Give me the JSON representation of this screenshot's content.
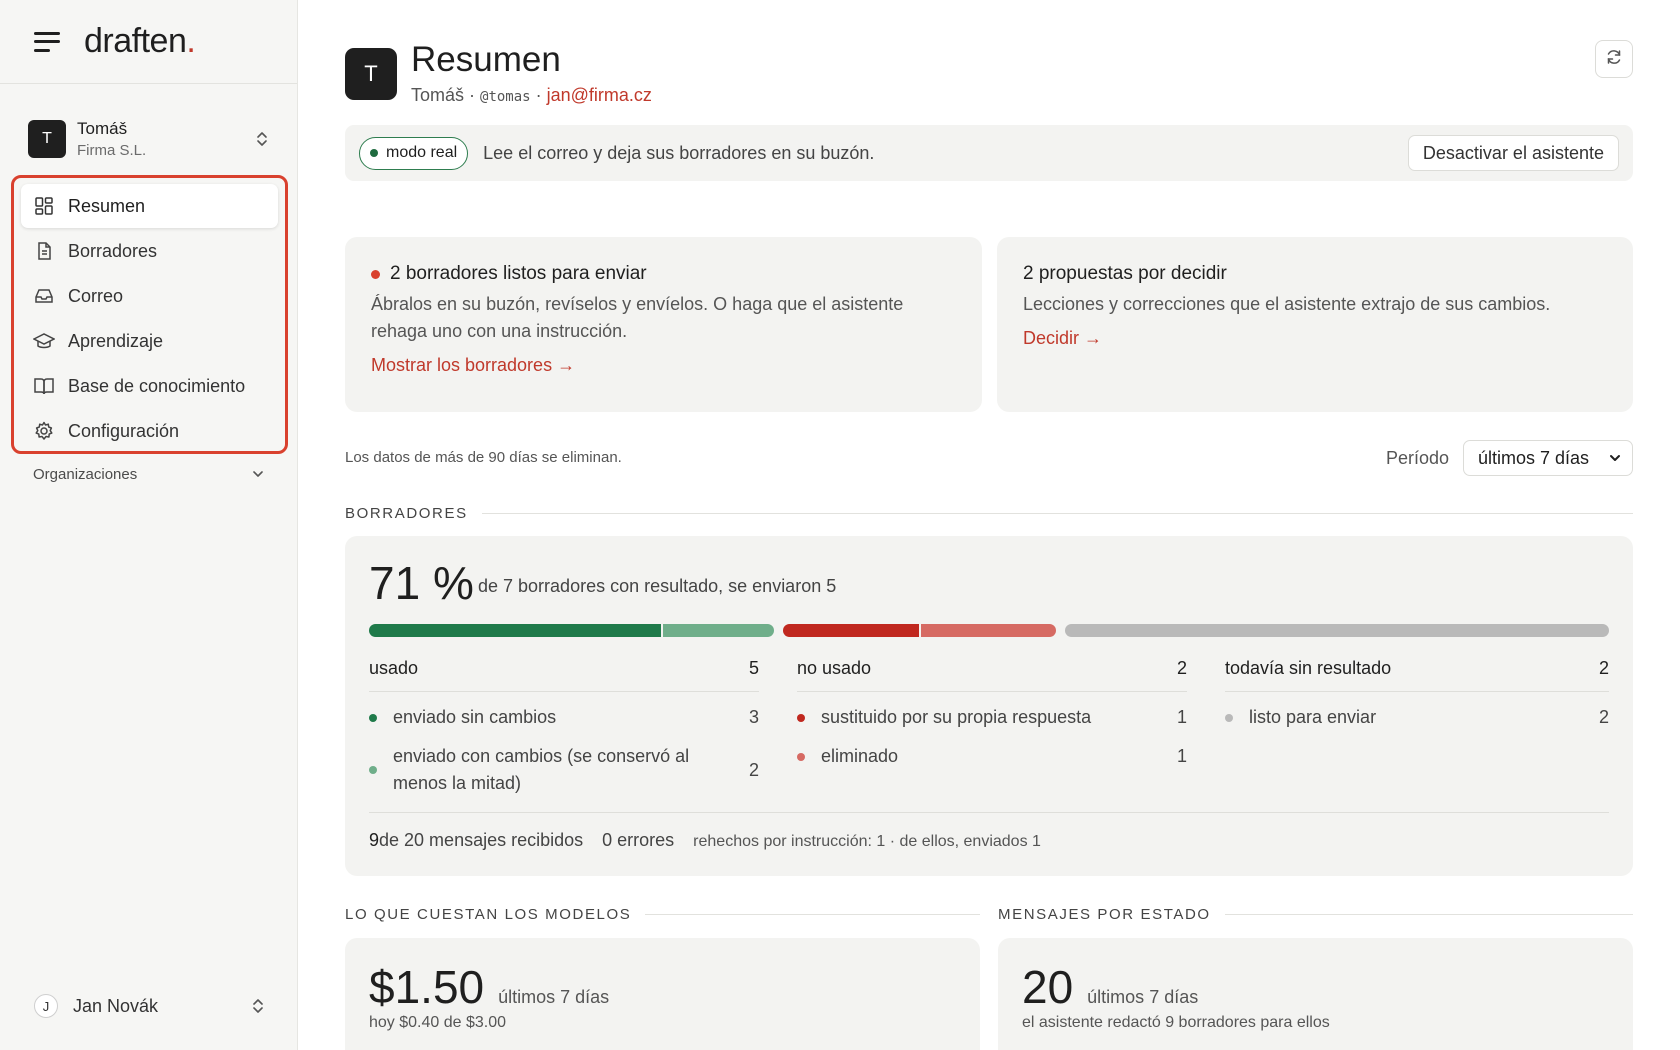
{
  "brand": {
    "logo": "draften",
    "logo_dot": "."
  },
  "account": {
    "initial": "T",
    "name": "Tomáš",
    "org": "Firma S.L."
  },
  "nav": {
    "items": [
      {
        "label": "Resumen",
        "icon": "grid-icon",
        "active": true
      },
      {
        "label": "Borradores",
        "icon": "document-icon"
      },
      {
        "label": "Correo",
        "icon": "inbox-icon"
      },
      {
        "label": "Aprendizaje",
        "icon": "graduation-cap-icon"
      },
      {
        "label": "Base de conocimiento",
        "icon": "book-icon"
      },
      {
        "label": "Configuración",
        "icon": "gear-icon"
      }
    ],
    "orgs_label": "Organizaciones"
  },
  "user": {
    "initial": "J",
    "name": "Jan Novák"
  },
  "header": {
    "initial": "T",
    "title": "Resumen",
    "name": "Tomáš",
    "sep1": " · ",
    "handle": "@tomas",
    "sep2": " · ",
    "email": "jan@firma.cz"
  },
  "banner": {
    "pill": "modo real",
    "text": "Lee el correo y deja sus borradores en su buzón.",
    "button": "Desactivar el asistente"
  },
  "cards": {
    "drafts_ready": {
      "title": "2 borradores listos para enviar",
      "text": "Ábralos en su buzón, revíselos y envíelos. O haga que el asistente rehaga uno con una instrucción.",
      "link": "Mostrar los borradores →"
    },
    "proposals": {
      "title": "2 propuestas por decidir",
      "text": "Lecciones y correcciones que el asistente extrajo de sus cambios.",
      "link": "Decidir →"
    }
  },
  "retention": "Los datos de más de 90 días se eliminan.",
  "period": {
    "label": "Período",
    "selected": "últimos 7 días"
  },
  "drafts": {
    "section": "BORRADORES",
    "pct": "71 %",
    "summary": "de 7 borradores con resultado, se enviaron 5",
    "bar": {
      "used_unchanged": 3,
      "used_changed": 2,
      "not_used_replaced": 1,
      "not_used_deleted": 1,
      "pending": 2,
      "colors": {
        "green_dark": "#1f7a4a",
        "green_light": "#6fae8a",
        "red_dark": "#c0281f",
        "red_light": "#d66a63",
        "grey": "#b9b9b9"
      }
    },
    "columns": [
      {
        "title": "usado",
        "count": "5",
        "rows": [
          {
            "label": "enviado sin cambios",
            "count": "3",
            "color": "#1f7a4a"
          },
          {
            "label": "enviado con cambios (se conservó al menos la mitad)",
            "count": "2",
            "color": "#6fae8a"
          }
        ]
      },
      {
        "title": "no usado",
        "count": "2",
        "rows": [
          {
            "label": "sustituido por su propia respuesta",
            "count": "1",
            "color": "#c0281f"
          },
          {
            "label": "eliminado",
            "count": "1",
            "color": "#d66a63"
          }
        ]
      },
      {
        "title": "todavía sin resultado",
        "count": "2",
        "rows": [
          {
            "label": "listo para enviar",
            "count": "2",
            "color": "#b9b9b9"
          }
        ]
      }
    ],
    "footer": {
      "received_num": "9",
      "received_text": " de 20 mensajes recibidos",
      "errors": "0 errores",
      "redo": "rehechos por instrucción: 1 · de ellos, enviados 1"
    }
  },
  "cost": {
    "section": "LO QUE CUESTAN LOS MODELOS",
    "value": "$1.50",
    "unit": "últimos 7 días",
    "sub": "hoy $0.40 de $3.00"
  },
  "states": {
    "section": "MENSAJES POR ESTADO",
    "value": "20",
    "unit": "últimos 7 días",
    "sub": "el asistente redactó 9 borradores para ellos"
  }
}
